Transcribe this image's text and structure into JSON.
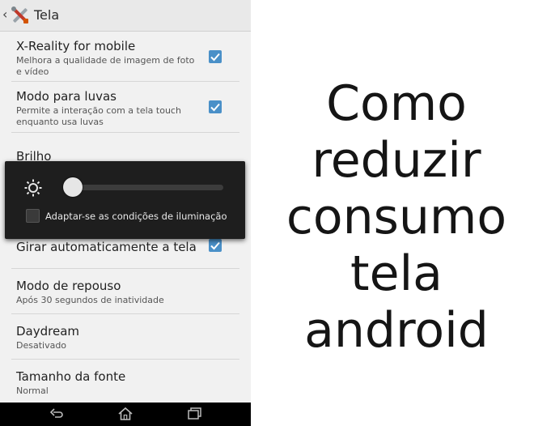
{
  "screen": {
    "title": "Tela",
    "settings": [
      {
        "title": "X-Reality for mobile",
        "subtitle": "Melhora a qualidade de imagem de foto e vídeo",
        "checked": true
      },
      {
        "title": "Modo para luvas",
        "subtitle": "Permite a interação com a tela touch enquanto usa luvas",
        "checked": true
      },
      {
        "title": "Brilho",
        "subtitle": ""
      },
      {
        "title": "Girar automaticamente a tela",
        "subtitle": "",
        "checked": true
      },
      {
        "title": "Modo de repouso",
        "subtitle": "Após 30 segundos de inatividade"
      },
      {
        "title": "Daydream",
        "subtitle": "Desativado"
      },
      {
        "title": "Tamanho da fonte",
        "subtitle": "Normal"
      }
    ]
  },
  "brightness_dialog": {
    "level": 0.05,
    "adapt_label": "Adaptar-se as condições de iluminação",
    "adapt_checked": false
  },
  "nav": {
    "icons": [
      "back-icon",
      "home-icon",
      "recent-apps-icon"
    ]
  },
  "headline": {
    "lines": [
      "Como",
      "reduzir",
      "consumo",
      "tela",
      "android"
    ]
  },
  "colors": {
    "checkbox": "#4a90c8",
    "dialog_bg": "#1e1e1e",
    "panel_bg": "#f1f1f1"
  }
}
